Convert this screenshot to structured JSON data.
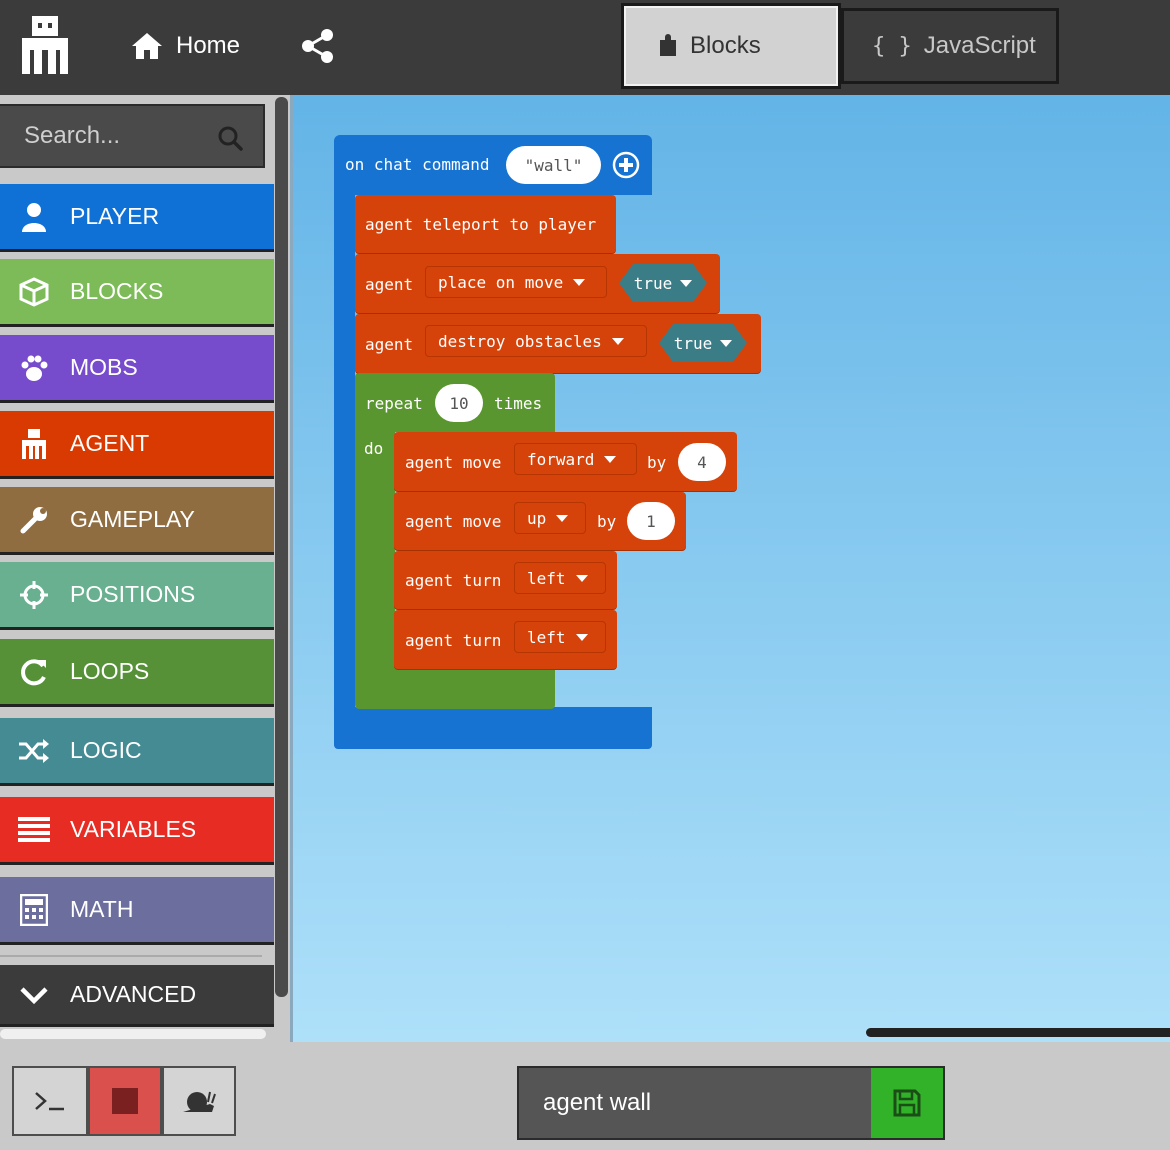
{
  "topbar": {
    "home_label": "Home",
    "tab_blocks": "Blocks",
    "tab_javascript": "JavaScript"
  },
  "sidebar": {
    "search_placeholder": "Search...",
    "categories": [
      {
        "label": "PLAYER",
        "color": "#0f71d6",
        "icon": "person-icon"
      },
      {
        "label": "BLOCKS",
        "color": "#7cbb58",
        "icon": "cube-icon"
      },
      {
        "label": "MOBS",
        "color": "#764bcc",
        "icon": "paw-icon"
      },
      {
        "label": "AGENT",
        "color": "#d83a02",
        "icon": "agent-icon"
      },
      {
        "label": "GAMEPLAY",
        "color": "#8f6d40",
        "icon": "wrench-icon"
      },
      {
        "label": "POSITIONS",
        "color": "#69b090",
        "icon": "crosshair-icon"
      },
      {
        "label": "LOOPS",
        "color": "#569138",
        "icon": "loop-icon"
      },
      {
        "label": "LOGIC",
        "color": "#458b93",
        "icon": "shuffle-icon"
      },
      {
        "label": "VARIABLES",
        "color": "#e72c24",
        "icon": "list-icon"
      },
      {
        "label": "MATH",
        "color": "#6c6f9e",
        "icon": "calculator-icon"
      },
      {
        "label": "ADVANCED",
        "color": "#3b3b3b",
        "icon": "chevron-down-icon"
      }
    ]
  },
  "workspace": {
    "event": {
      "prefix": "on chat command",
      "command": "\"wall\""
    },
    "teleport": "agent teleport to player",
    "place": {
      "prefix": "agent",
      "dropdown": "place on move",
      "value": "true"
    },
    "destroy": {
      "prefix": "agent",
      "dropdown": "destroy obstacles",
      "value": "true"
    },
    "repeat": {
      "prefix": "repeat",
      "count": "10",
      "suffix": "times",
      "do": "do"
    },
    "move1": {
      "prefix": "agent move",
      "direction": "forward",
      "by": "by",
      "amount": "4"
    },
    "move2": {
      "prefix": "agent move",
      "direction": "up",
      "by": "by",
      "amount": "1"
    },
    "turn1": {
      "prefix": "agent turn",
      "direction": "left"
    },
    "turn2": {
      "prefix": "agent turn",
      "direction": "left"
    }
  },
  "bottombar": {
    "project_name": "agent wall"
  }
}
